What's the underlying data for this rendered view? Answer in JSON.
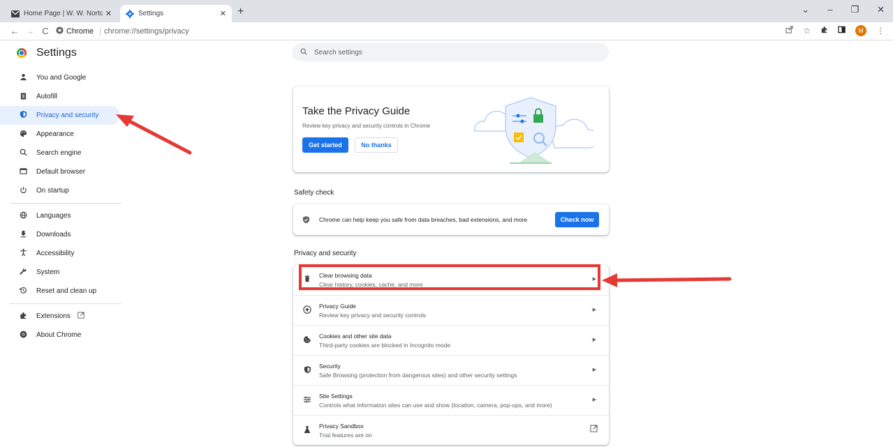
{
  "tabs": [
    {
      "title": "Home Page | W. W. Norton & Co",
      "icon": "mail-icon"
    },
    {
      "title": "Settings",
      "icon": "gear-icon"
    }
  ],
  "tab_close": "✕",
  "new_tab": "+",
  "window_controls": {
    "dropdown": "⌄",
    "minimize": "–",
    "restore": "❐",
    "close": "✕"
  },
  "toolbar": {
    "back": "←",
    "forward": "→",
    "reload": "C",
    "site_label": "Chrome",
    "url": "chrome://settings/privacy",
    "avatar_letter": "M",
    "avatar_color": "#e37400"
  },
  "header": {
    "title": "Settings",
    "search_placeholder": "Search settings"
  },
  "sidebar": {
    "items": [
      {
        "label": "You and Google",
        "icon": "person-icon"
      },
      {
        "label": "Autofill",
        "icon": "clipboard-icon"
      },
      {
        "label": "Privacy and security",
        "icon": "shield-icon"
      },
      {
        "label": "Appearance",
        "icon": "palette-icon"
      },
      {
        "label": "Search engine",
        "icon": "search-icon"
      },
      {
        "label": "Default browser",
        "icon": "browser-icon"
      },
      {
        "label": "On startup",
        "icon": "power-icon"
      },
      {
        "label": "Languages",
        "icon": "globe-icon"
      },
      {
        "label": "Downloads",
        "icon": "download-icon"
      },
      {
        "label": "Accessibility",
        "icon": "accessibility-icon"
      },
      {
        "label": "System",
        "icon": "wrench-icon"
      },
      {
        "label": "Reset and clean up",
        "icon": "reset-icon"
      },
      {
        "label": "Extensions",
        "icon": "puzzle-icon"
      },
      {
        "label": "About Chrome",
        "icon": "chrome-icon"
      }
    ],
    "active_index": 2
  },
  "privacy_guide": {
    "title": "Take the Privacy Guide",
    "description": "Review key privacy and security controls in Chrome",
    "get_started": "Get started",
    "no_thanks": "No thanks"
  },
  "safety_check": {
    "heading": "Safety check",
    "text": "Chrome can help keep you safe from data breaches, bad extensions, and more",
    "button": "Check now"
  },
  "privacy_section": {
    "heading": "Privacy and security",
    "rows": [
      {
        "title": "Clear browsing data",
        "subtitle": "Clear history, cookies, cache, and more",
        "icon": "trash-icon",
        "action": "arrow"
      },
      {
        "title": "Privacy Guide",
        "subtitle": "Review key privacy and security controls",
        "icon": "compass-icon",
        "action": "arrow"
      },
      {
        "title": "Cookies and other site data",
        "subtitle": "Third-party cookies are blocked in Incognito mode",
        "icon": "cookie-icon",
        "action": "arrow"
      },
      {
        "title": "Security",
        "subtitle": "Safe Browsing (protection from dangerous sites) and other security settings",
        "icon": "shield-icon",
        "action": "arrow"
      },
      {
        "title": "Site Settings",
        "subtitle": "Controls what information sites can use and show (location, camera, pop-ups, and more)",
        "icon": "sliders-icon",
        "action": "arrow"
      },
      {
        "title": "Privacy Sandbox",
        "subtitle": "Trial features are on",
        "icon": "flask-icon",
        "action": "external"
      }
    ]
  },
  "colors": {
    "accent": "#1a73e8",
    "active_nav_bg": "#e8f0fe",
    "annotation": "#e53935"
  }
}
